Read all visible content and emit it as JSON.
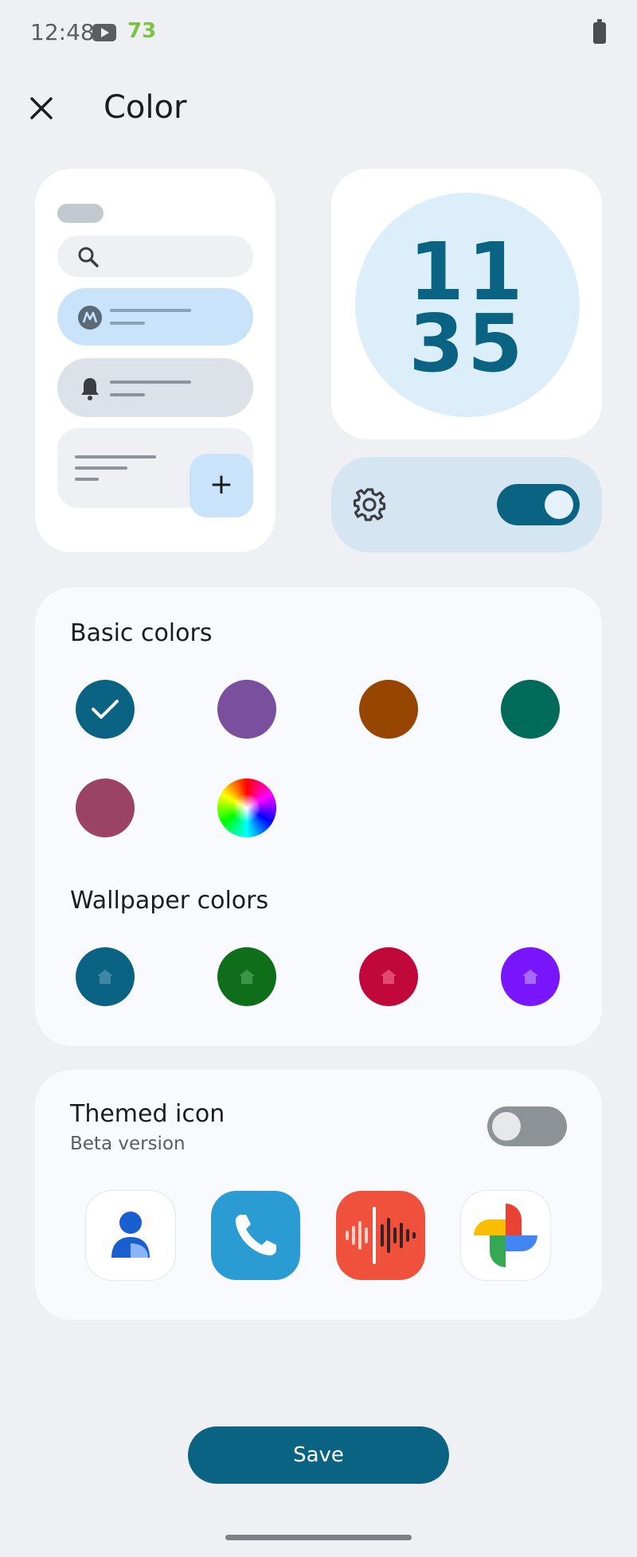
{
  "status_bar": {
    "time": "12:48",
    "notification_count": "73"
  },
  "header": {
    "title": "Color"
  },
  "preview": {
    "clock_hour": "11",
    "clock_minute": "35",
    "fab_symbol": "+"
  },
  "basic_colors": {
    "label": "Basic colors",
    "selected_index": 0,
    "swatches": [
      "#0b6384",
      "#7a4f9e",
      "#974601",
      "#006b5b",
      "#9a4364",
      "rainbow"
    ]
  },
  "wallpaper_colors": {
    "label": "Wallpaper colors",
    "swatches": [
      "#0b6384",
      "#0f6e1a",
      "#c0083a",
      "#7a16ff"
    ]
  },
  "themed_icon": {
    "title": "Themed icon",
    "subtitle": "Beta version",
    "enabled": false,
    "apps": [
      "contacts-icon",
      "phone-icon",
      "recorder-icon",
      "photos-icon"
    ]
  },
  "save_label": "Save",
  "accent_color": "#0b6384"
}
